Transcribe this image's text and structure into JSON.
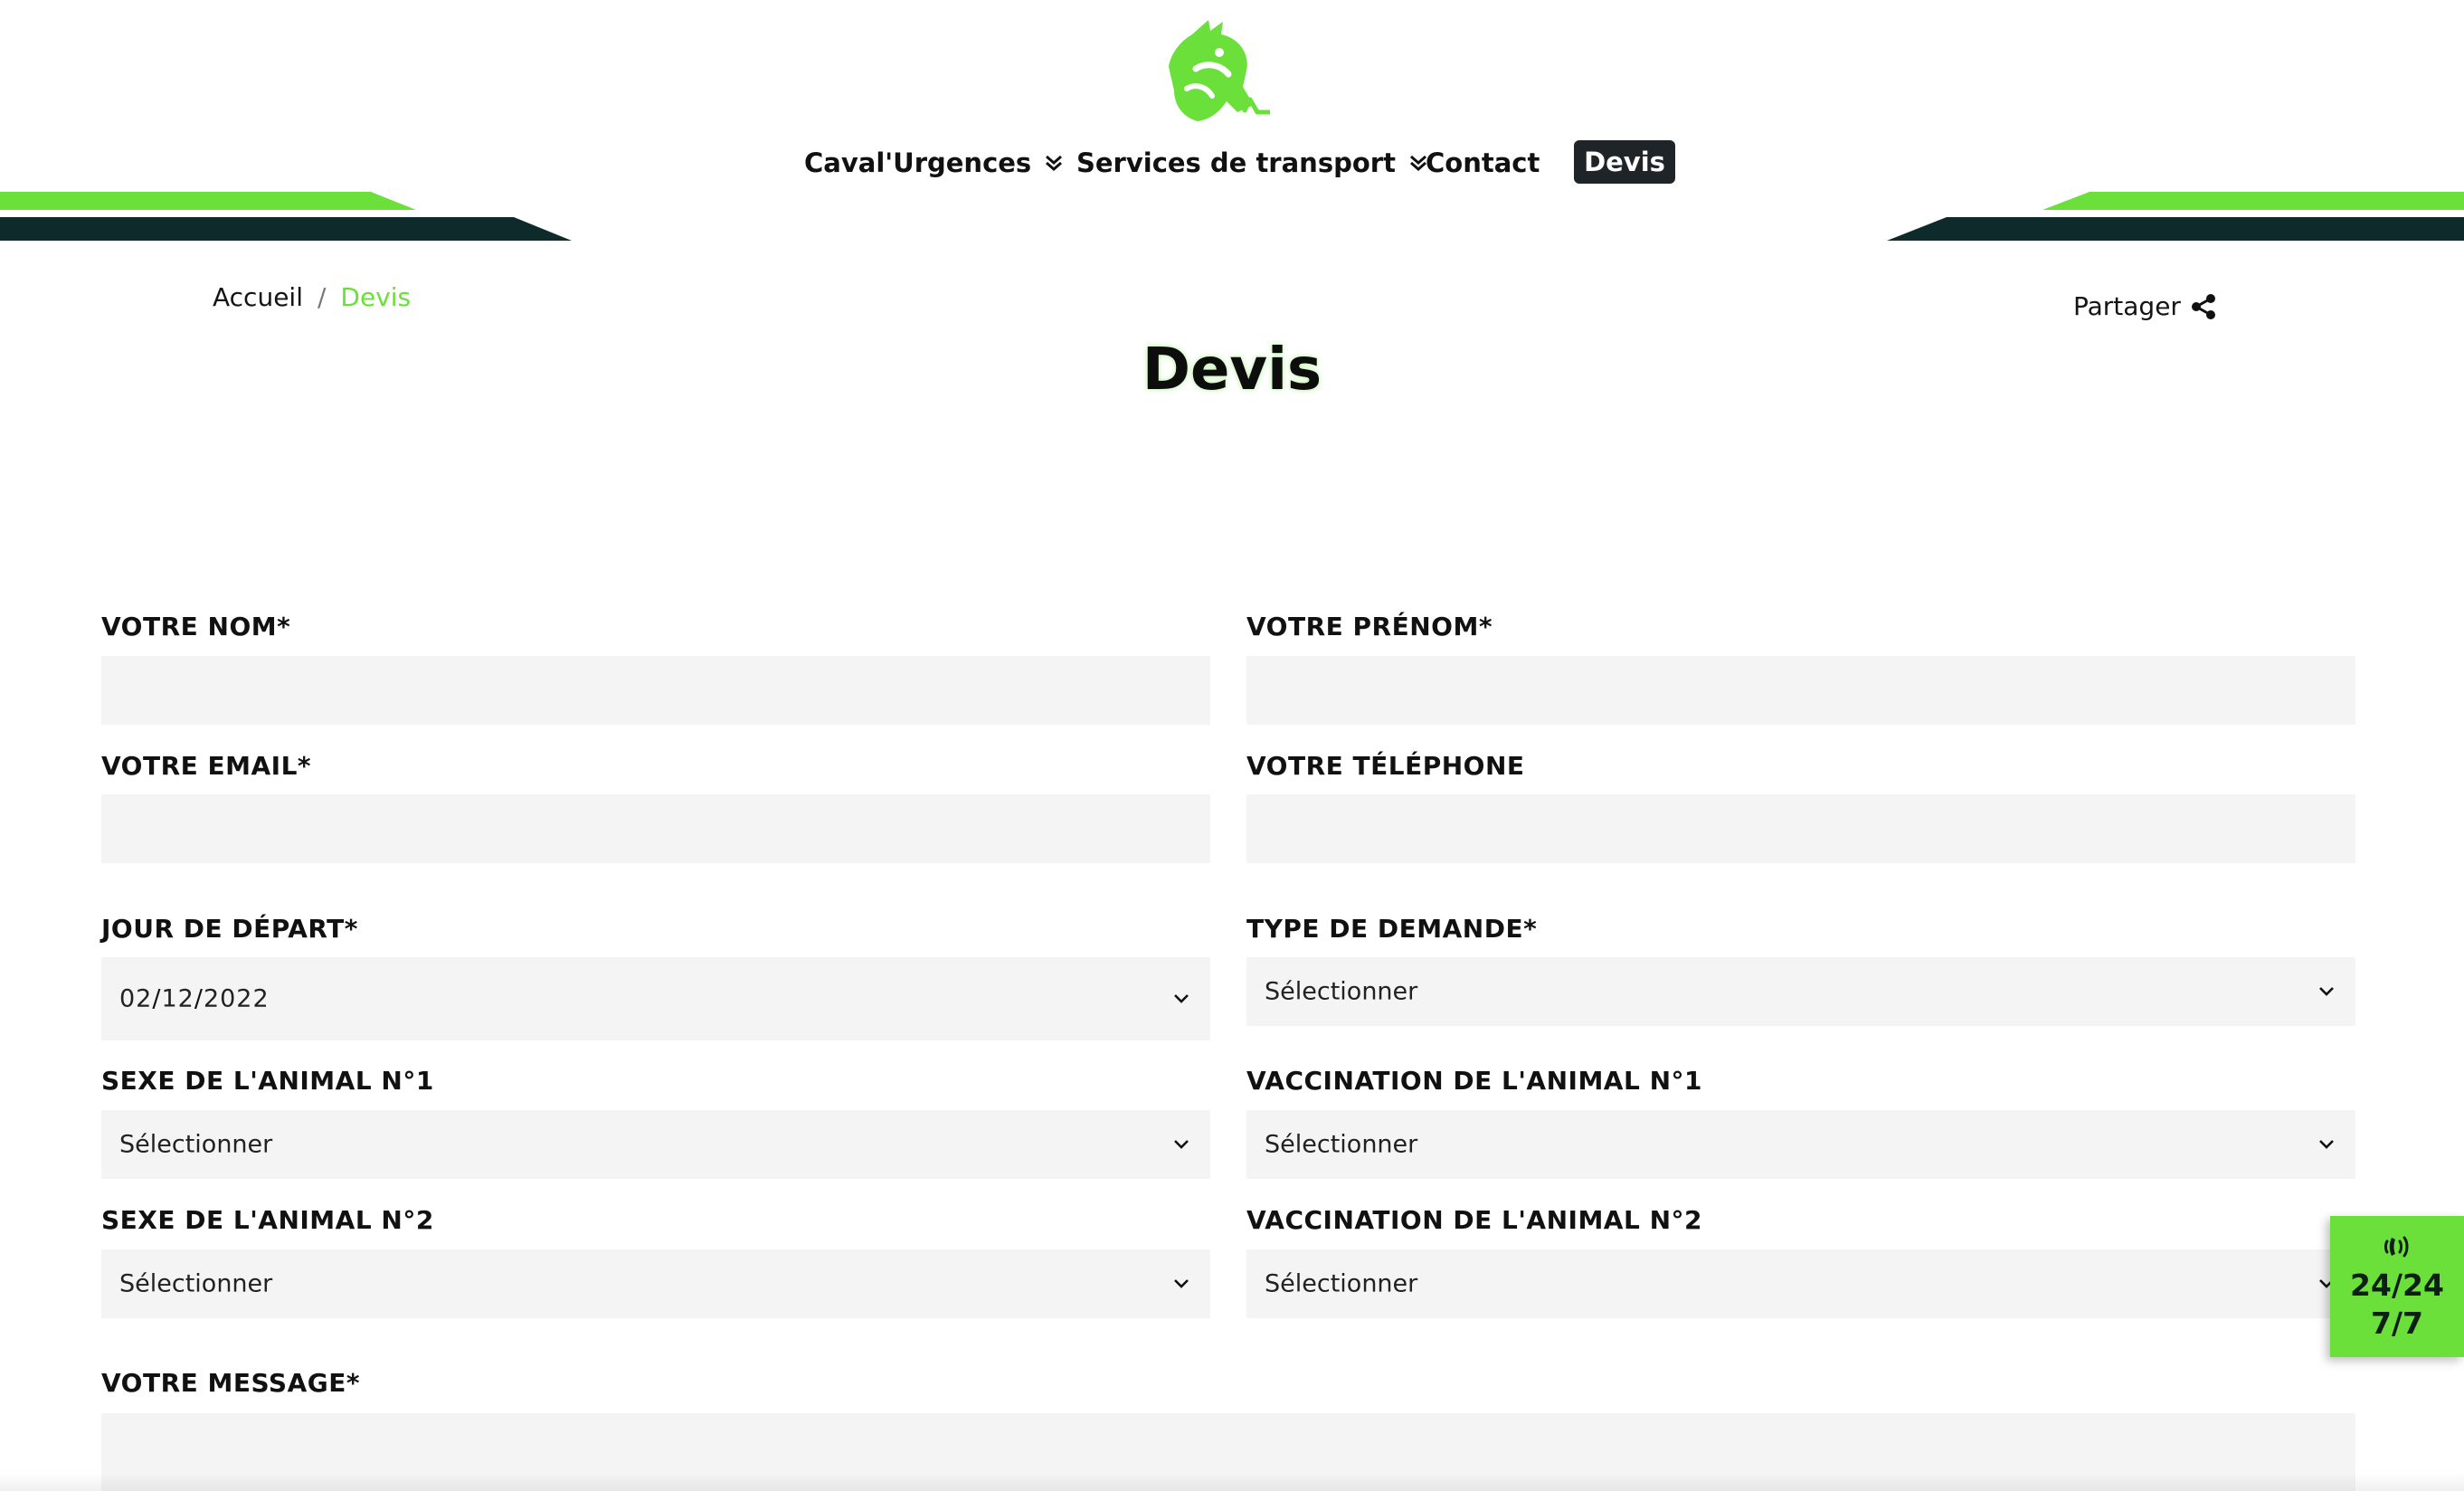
{
  "nav": {
    "items": [
      {
        "label": "Caval'Urgences"
      },
      {
        "label": "Services de transport"
      },
      {
        "label": "Contact"
      }
    ],
    "active": "Devis"
  },
  "breadcrumb": {
    "home": "Accueil",
    "separator": "/",
    "current": "Devis"
  },
  "share_label": "Partager",
  "page_title": "Devis",
  "form": {
    "nom_label": "VOTRE NOM*",
    "prenom_label": "VOTRE PRÉNOM*",
    "email_label": "VOTRE EMAIL*",
    "telephone_label": "VOTRE TÉLÉPHONE",
    "jour_label": "JOUR DE DÉPART*",
    "jour_day": "02",
    "jour_month": "12",
    "jour_year": "2022",
    "date_sep": "/",
    "type_label": "TYPE DE DEMANDE*",
    "type_value": "Sélectionner",
    "sexe1_label": "SEXE DE L'ANIMAL N°1",
    "sexe1_value": "Sélectionner",
    "vacc1_label": "VACCINATION DE L'ANIMAL N°1",
    "vacc1_value": "Sélectionner",
    "sexe2_label": "SEXE DE L'ANIMAL N°2",
    "sexe2_value": "Sélectionner",
    "vacc2_label": "VACCINATION DE L'ANIMAL N°2",
    "vacc2_value": "Sélectionner",
    "message_label": "VOTRE MESSAGE*"
  },
  "badge": {
    "line1": "24/24",
    "line2": "7/7"
  },
  "colors": {
    "accent": "#6be03a",
    "dark": "#0f2a2a",
    "field_bg": "#f4f4f4",
    "active_nav_bg": "#1e2428"
  }
}
